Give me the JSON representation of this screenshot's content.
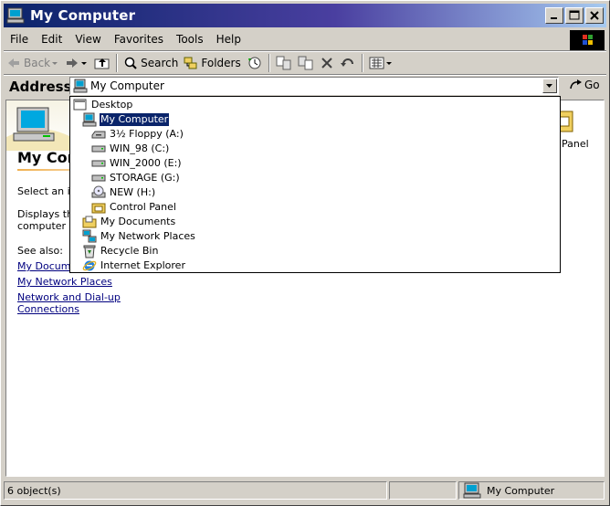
{
  "window": {
    "title": "My Computer",
    "title_icon": "my-computer-icon"
  },
  "menu": [
    "File",
    "Edit",
    "View",
    "Favorites",
    "Tools",
    "Help"
  ],
  "toolbar": {
    "back_label": "Back",
    "search_label": "Search",
    "folders_label": "Folders"
  },
  "address": {
    "label": "Address",
    "value": "My Computer",
    "go_label": "Go"
  },
  "dropdown": {
    "items": [
      {
        "label": "Desktop",
        "icon": "desktop-icon",
        "level": 0
      },
      {
        "label": "My Computer",
        "icon": "my-computer-icon",
        "level": 1,
        "selected": true
      },
      {
        "label": "3½ Floppy (A:)",
        "icon": "floppy-drive-icon",
        "level": 2
      },
      {
        "label": "WIN_98 (C:)",
        "icon": "hard-drive-icon",
        "level": 2
      },
      {
        "label": "WIN_2000 (E:)",
        "icon": "hard-drive-icon",
        "level": 2
      },
      {
        "label": "STORAGE (G:)",
        "icon": "hard-drive-icon",
        "level": 2
      },
      {
        "label": "NEW (H:)",
        "icon": "cd-drive-icon",
        "level": 2
      },
      {
        "label": "Control Panel",
        "icon": "control-panel-icon",
        "level": 2
      },
      {
        "label": "My Documents",
        "icon": "folder-icon",
        "level": 1
      },
      {
        "label": "My Network Places",
        "icon": "network-places-icon",
        "level": 1
      },
      {
        "label": "Recycle Bin",
        "icon": "recycle-bin-icon",
        "level": 1
      },
      {
        "label": "Internet Explorer",
        "icon": "internet-explorer-icon",
        "level": 1
      }
    ]
  },
  "webview": {
    "title": "My Com",
    "select_text": "Select an ite",
    "desc_line1": "Displays the",
    "desc_line2": "computer",
    "see_also": "See also:",
    "links": [
      "My Documen",
      "My Network Places",
      "Network and Dial-up Connections"
    ]
  },
  "content": {
    "control_panel_label": "Panel"
  },
  "status": {
    "count_text": "6 object(s)",
    "zone_text": "My Computer"
  },
  "colors": {
    "title_start": "#0a246a",
    "title_end": "#a6caf0",
    "selection": "#0a246a",
    "link": "#00007f"
  }
}
